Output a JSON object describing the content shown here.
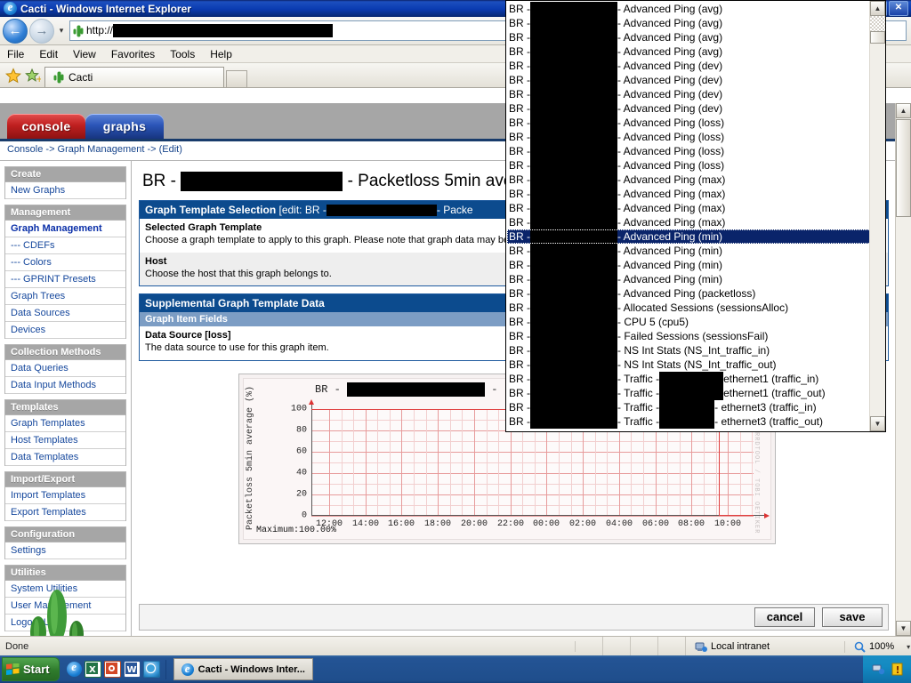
{
  "window": {
    "title": "Cacti - Windows Internet Explorer",
    "icon": "ie-icon",
    "buttons": [
      {
        "name": "minimize-button",
        "glyph": "_"
      },
      {
        "name": "restore-button",
        "glyph": "❐"
      },
      {
        "name": "close-button",
        "glyph": "✕"
      }
    ]
  },
  "navbar": {
    "back_label": "←",
    "forward_label": "→",
    "history_caret": "▾",
    "address_prefix": "http://",
    "address_redacted_width": 247,
    "address_favicon": "cacti-icon"
  },
  "menubar": {
    "items": [
      "File",
      "Edit",
      "View",
      "Favorites",
      "Tools",
      "Help"
    ]
  },
  "favbar": {
    "favorites_icon": "star-icon",
    "add-favorites_icon": "add-to-favorites-icon",
    "tab_label": "Cacti",
    "tab_icon": "cacti-icon",
    "new_tab_label": ""
  },
  "cacti": {
    "tabs": [
      {
        "name": "tab-console",
        "label": "console"
      },
      {
        "name": "tab-graphs",
        "label": "graphs"
      }
    ],
    "breadcrumb": "Console -> Graph Management -> (Edit)",
    "sidebar": [
      {
        "type": "head",
        "label": "Create"
      },
      {
        "type": "item",
        "label": "New Graphs"
      },
      {
        "type": "head",
        "label": "Management"
      },
      {
        "type": "item",
        "label": "Graph Management",
        "selected": true
      },
      {
        "type": "item",
        "label": "--- CDEFs"
      },
      {
        "type": "item",
        "label": "--- Colors"
      },
      {
        "type": "item",
        "label": "--- GPRINT Presets"
      },
      {
        "type": "item",
        "label": "Graph Trees"
      },
      {
        "type": "item",
        "label": "Data Sources"
      },
      {
        "type": "item",
        "label": "Devices"
      },
      {
        "type": "head",
        "label": "Collection Methods"
      },
      {
        "type": "item",
        "label": "Data Queries"
      },
      {
        "type": "item",
        "label": "Data Input Methods"
      },
      {
        "type": "head",
        "label": "Templates"
      },
      {
        "type": "item",
        "label": "Graph Templates"
      },
      {
        "type": "item",
        "label": "Host Templates"
      },
      {
        "type": "item",
        "label": "Data Templates"
      },
      {
        "type": "head",
        "label": "Import/Export"
      },
      {
        "type": "item",
        "label": "Import Templates"
      },
      {
        "type": "item",
        "label": "Export Templates"
      },
      {
        "type": "head",
        "label": "Configuration"
      },
      {
        "type": "item",
        "label": "Settings"
      },
      {
        "type": "head",
        "label": "Utilities"
      },
      {
        "type": "item",
        "label": "System Utilities"
      },
      {
        "type": "item",
        "label": "User Management"
      },
      {
        "type": "item",
        "label": "Logout User"
      }
    ],
    "page_title_prefix": "BR -",
    "page_title_redacted_width": 182,
    "page_title_suffix": "- Packetloss 5min ave",
    "panels": [
      {
        "name": "graph-template-selection",
        "title": "Graph Template Selection",
        "title_edit_prefix": "[edit: BR -",
        "title_redacted_width": 124,
        "title_edit_suffix": "- Packe",
        "rows": [
          {
            "label": "Selected Graph Template",
            "help": "Choose a graph template to apply to this graph. Please note that graph data may be lost if you change the graph template after one is already applied."
          },
          {
            "label": "Host",
            "help": "Choose the host that this graph belongs to."
          }
        ]
      },
      {
        "name": "supplemental-graph-template-data",
        "title": "Supplemental Graph Template Data",
        "subtitle": "Graph Item Fields",
        "rows": [
          {
            "label": "Data Source [loss]",
            "help": "The data source to use for this graph item."
          }
        ]
      }
    ],
    "buttons": [
      {
        "name": "cancel-button",
        "label": "cancel"
      },
      {
        "name": "save-button",
        "label": "save"
      }
    ]
  },
  "dropdown": {
    "name": "data-source-dropdown",
    "selected_index": 16,
    "scroll_up_glyph": "▲",
    "scroll_down_glyph": "▼",
    "options": [
      {
        "prefix": "BR -",
        "blk": 98,
        "text": "- Advanced Ping (avg)"
      },
      {
        "prefix": "BR -",
        "blk": 98,
        "text": "- Advanced Ping (avg)"
      },
      {
        "prefix": "BR -",
        "blk": 98,
        "text": "- Advanced Ping (avg)"
      },
      {
        "prefix": "BR -",
        "blk": 98,
        "text": "- Advanced Ping (avg)"
      },
      {
        "prefix": "BR -",
        "blk": 98,
        "text": "- Advanced Ping (dev)"
      },
      {
        "prefix": "BR -",
        "blk": 98,
        "text": "- Advanced Ping (dev)"
      },
      {
        "prefix": "BR -",
        "blk": 98,
        "text": "- Advanced Ping (dev)"
      },
      {
        "prefix": "BR -",
        "blk": 98,
        "text": "- Advanced Ping (dev)"
      },
      {
        "prefix": "BR -",
        "blk": 98,
        "text": "- Advanced Ping (loss)"
      },
      {
        "prefix": "BR -",
        "blk": 98,
        "text": "- Advanced Ping (loss)"
      },
      {
        "prefix": "BR -",
        "blk": 98,
        "text": "- Advanced Ping (loss)"
      },
      {
        "prefix": "BR -",
        "blk": 98,
        "text": "- Advanced Ping (loss)"
      },
      {
        "prefix": "BR -",
        "blk": 98,
        "text": "- Advanced Ping (max)"
      },
      {
        "prefix": "BR -",
        "blk": 98,
        "text": "- Advanced Ping (max)"
      },
      {
        "prefix": "BR -",
        "blk": 98,
        "text": "- Advanced Ping (max)"
      },
      {
        "prefix": "BR -",
        "blk": 98,
        "text": "- Advanced Ping (max)"
      },
      {
        "prefix": "BR -",
        "blk": 98,
        "text": "- Advanced Ping (min)"
      },
      {
        "prefix": "BR -",
        "blk": 98,
        "text": "- Advanced Ping (min)"
      },
      {
        "prefix": "BR -",
        "blk": 98,
        "text": "- Advanced Ping (min)"
      },
      {
        "prefix": "BR -",
        "blk": 98,
        "text": "- Advanced Ping (min)"
      },
      {
        "prefix": "BR -",
        "blk": 98,
        "text": "- Advanced Ping (packetloss)"
      },
      {
        "prefix": "BR -",
        "blk": 98,
        "text": "- Allocated Sessions (sessionsAlloc)"
      },
      {
        "prefix": "BR -",
        "blk": 98,
        "text": "- CPU 5 (cpu5)"
      },
      {
        "prefix": "BR -",
        "blk": 98,
        "text": "- Failed Sessions (sessionsFail)"
      },
      {
        "prefix": "BR -",
        "blk": 98,
        "text": "- NS Int Stats (NS_Int_traffic_in)"
      },
      {
        "prefix": "BR -",
        "blk": 98,
        "text": "- NS Int Stats (NS_Int_traffic_out)"
      },
      {
        "prefix": "BR -",
        "blk": 98,
        "text": "- Traffic -",
        "blk2": 72,
        "text2": "ethernet1 (traffic_in)"
      },
      {
        "prefix": "BR -",
        "blk": 98,
        "text": "- Traffic -",
        "blk2": 72,
        "text2": "ethernet1 (traffic_out)"
      },
      {
        "prefix": "BR -",
        "blk": 98,
        "text": "- Traffic -",
        "blk2": 62,
        "text2": "- ethernet3 (traffic_in)"
      },
      {
        "prefix": "BR -",
        "blk": 98,
        "text": "- Traffic -",
        "blk2": 62,
        "text2": "- ethernet3 (traffic_out)"
      }
    ]
  },
  "chart_data": {
    "type": "line",
    "title_prefix": "BR -",
    "title_redacted_width": 155,
    "title_suffix": "-",
    "ylabel": "Packetloss 5min average (%)",
    "xlabel": "",
    "ylim": [
      0,
      100
    ],
    "yticks": [
      0,
      20,
      40,
      60,
      80,
      100
    ],
    "xticks": [
      "12:00",
      "14:00",
      "16:00",
      "18:00",
      "20:00",
      "22:00",
      "00:00",
      "02:00",
      "04:00",
      "06:00",
      "08:00",
      "10:00"
    ],
    "series": [
      {
        "name": "loss",
        "color": "#e04040",
        "x": [
          "12:00",
          "10:05",
          "10:20"
        ],
        "values": [
          100,
          100,
          0
        ],
        "description": "Flat at 100% across the whole window, dropping to 0% just before 10:00"
      }
    ],
    "annotations": [
      "Maximum:100.00%"
    ],
    "legend_position": "none",
    "grid": true,
    "watermark": "RRDTOOL / TOBI OETIKER"
  },
  "statusbar": {
    "text": "Done",
    "zone": "Local intranet",
    "zone_icon": "intranet-icon",
    "zoom": "100%",
    "zoom_icon": "magnifier-icon",
    "zoom_caret": "▾"
  },
  "taskbar": {
    "start_label": "Start",
    "quick_launch": [
      {
        "name": "ql-internet-explorer-icon"
      },
      {
        "name": "ql-excel-icon",
        "glyph": "X"
      },
      {
        "name": "ql-outlook-icon",
        "glyph": "O"
      },
      {
        "name": "ql-word-icon",
        "glyph": "W"
      },
      {
        "name": "ql-messenger-icon",
        "glyph": "◑"
      }
    ],
    "tasks": [
      {
        "name": "taskbar-item-cacti",
        "label": "Cacti - Windows Inter...",
        "icon": "ie-icon"
      }
    ],
    "tray": [
      {
        "name": "tray-network-icon"
      },
      {
        "name": "tray-alert-icon",
        "glyph": "!"
      }
    ]
  }
}
